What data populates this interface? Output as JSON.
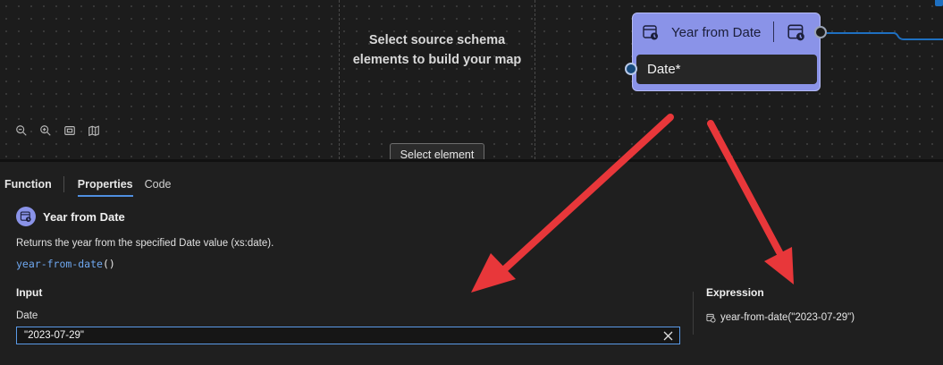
{
  "canvas": {
    "empty_message": "Select source schema elements to build your map",
    "select_element_label": "Select element",
    "zoom_controls": [
      "zoom-out-icon",
      "zoom-in-icon",
      "fit-to-screen-icon",
      "map-icon"
    ]
  },
  "node": {
    "title": "Year from Date",
    "input_label": "Date*",
    "icon": "calendar-clock-icon",
    "color": "#8a93e8"
  },
  "panel": {
    "tabs": {
      "function": "Function",
      "properties": "Properties",
      "code": "Code"
    },
    "function_name": "Year from Date",
    "description": "Returns the year from the specified Date value (xs:date).",
    "signature_name": "year-from-date",
    "signature_parens": "()",
    "input_heading": "Input",
    "input_label": "Date",
    "input_value": "\"2023-07-29\"",
    "expression_heading": "Expression",
    "expression_value": "year-from-date(\"2023-07-29\")"
  },
  "colors": {
    "accent": "#4f8ee0",
    "node": "#8a93e8",
    "annotation_arrow": "#e8373a"
  }
}
